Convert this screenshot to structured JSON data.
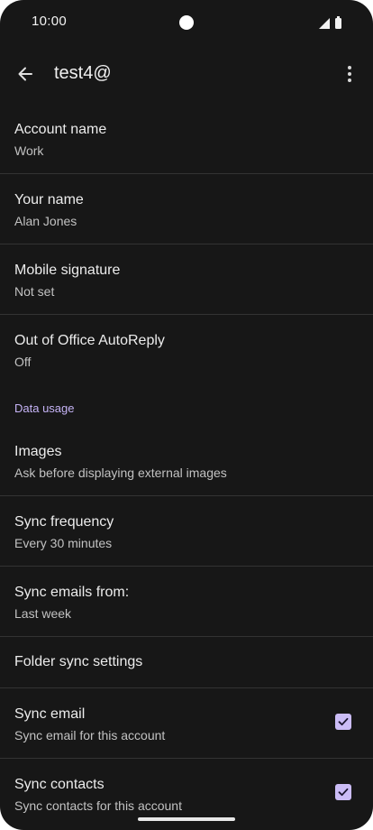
{
  "status_bar": {
    "time": "10:00"
  },
  "app_bar": {
    "title": "test4@"
  },
  "settings": {
    "account_name": {
      "title": "Account name",
      "value": "Work"
    },
    "your_name": {
      "title": "Your name",
      "value": "Alan Jones"
    },
    "mobile_signature": {
      "title": "Mobile signature",
      "value": "Not set"
    },
    "out_of_office": {
      "title": "Out of Office AutoReply",
      "value": "Off"
    },
    "data_usage_header": "Data usage",
    "images": {
      "title": "Images",
      "value": "Ask before displaying external images"
    },
    "sync_frequency": {
      "title": "Sync frequency",
      "value": "Every 30 minutes"
    },
    "sync_emails_from": {
      "title": "Sync emails from:",
      "value": "Last week"
    },
    "folder_sync": {
      "title": "Folder sync settings"
    },
    "sync_email": {
      "title": "Sync email",
      "value": "Sync email for this account",
      "checked": true
    },
    "sync_contacts": {
      "title": "Sync contacts",
      "value": "Sync contacts for this account",
      "checked": true
    }
  },
  "colors": {
    "background": "#171717",
    "accent": "#c5b3f5",
    "checkbox": "#cbbcf6",
    "divider": "#333333"
  },
  "icons": {
    "back": "arrow-back-icon",
    "more": "more-vert-icon",
    "signal": "signal-icon",
    "battery": "battery-icon",
    "check": "check-icon"
  }
}
